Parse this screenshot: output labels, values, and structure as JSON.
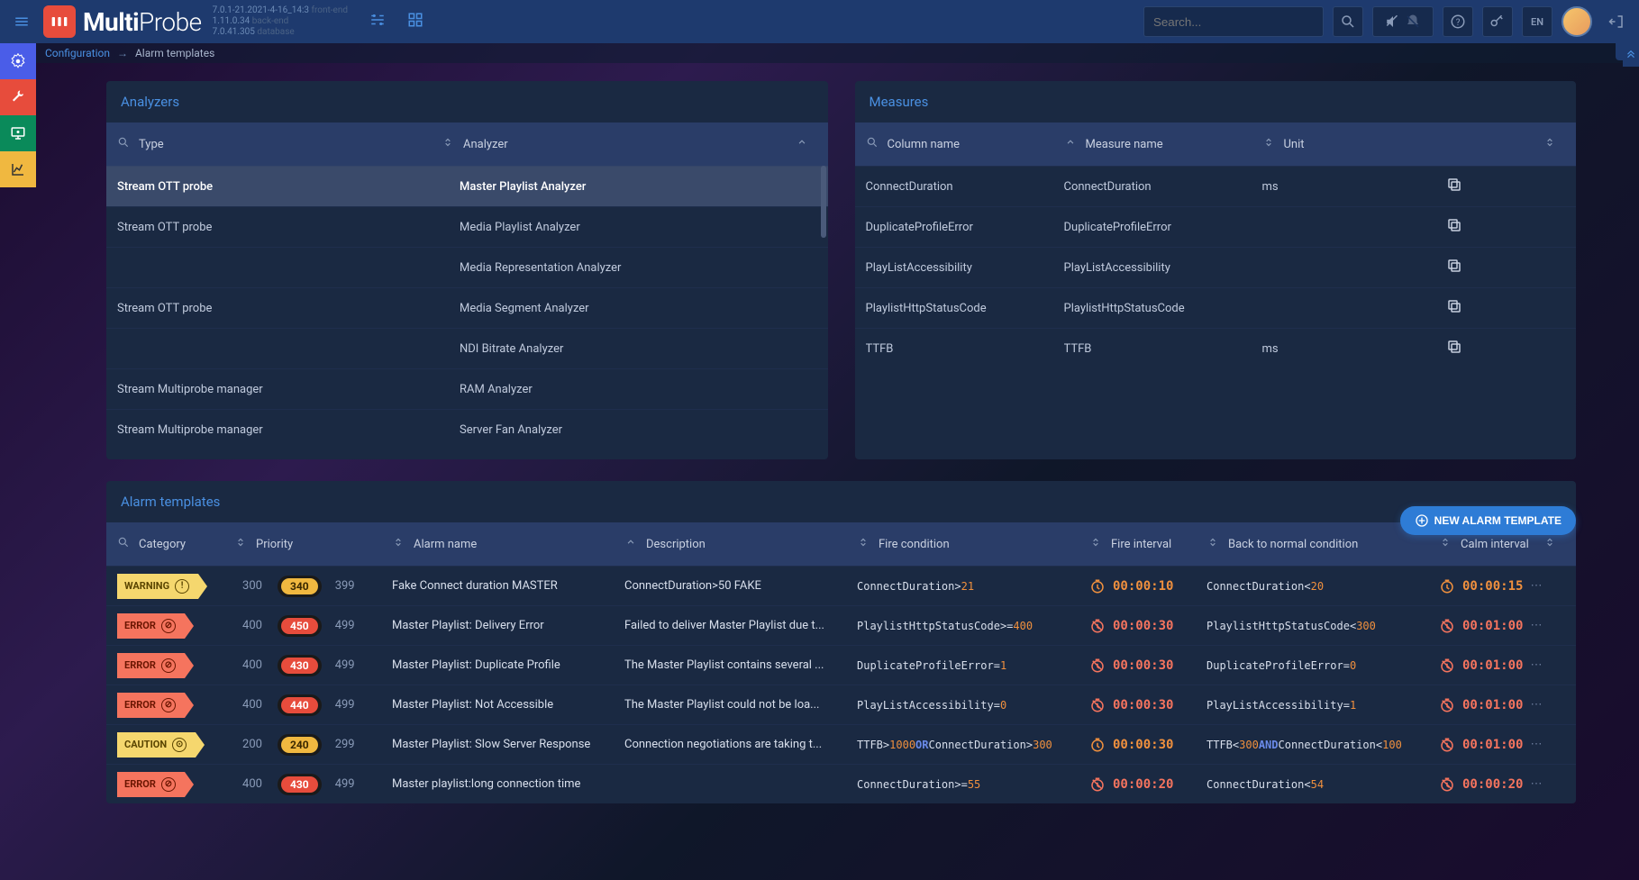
{
  "brand": {
    "name_bold": "Multi",
    "name_light": "Probe"
  },
  "versions": {
    "line1": "7.0.1-21.2021-4-16_14:3",
    "label1": "front-end",
    "line2": "1.11.0.34",
    "label2": "back-end",
    "line3": "7.0.41.305",
    "label3": "database"
  },
  "search": {
    "placeholder": "Search..."
  },
  "lang": "EN",
  "breadcrumb": {
    "root": "Configuration",
    "current": "Alarm templates",
    "sep": "→"
  },
  "analyzers": {
    "title": "Analyzers",
    "cols": {
      "type": "Type",
      "analyzer": "Analyzer"
    },
    "rows": [
      {
        "type": "Stream OTT probe",
        "analyzer": "Master Playlist Analyzer",
        "selected": true
      },
      {
        "type": "Stream OTT probe",
        "analyzer": "Media Playlist Analyzer"
      },
      {
        "type": "",
        "analyzer": "Media Representation Analyzer"
      },
      {
        "type": "Stream OTT probe",
        "analyzer": "Media Segment Analyzer"
      },
      {
        "type": "",
        "analyzer": "NDI Bitrate Analyzer"
      },
      {
        "type": "Stream Multiprobe manager",
        "analyzer": "RAM Analyzer"
      },
      {
        "type": "Stream Multiprobe manager",
        "analyzer": "Server Fan Analyzer"
      }
    ]
  },
  "measures": {
    "title": "Measures",
    "cols": {
      "column": "Column name",
      "measure": "Measure name",
      "unit": "Unit"
    },
    "rows": [
      {
        "col": "ConnectDuration",
        "meas": "ConnectDuration",
        "unit": "ms"
      },
      {
        "col": "DuplicateProfileError",
        "meas": "DuplicateProfileError",
        "unit": ""
      },
      {
        "col": "PlayListAccessibility",
        "meas": "PlayListAccessibility",
        "unit": ""
      },
      {
        "col": "PlaylistHttpStatusCode",
        "meas": "PlaylistHttpStatusCode",
        "unit": ""
      },
      {
        "col": "TTFB",
        "meas": "TTFB",
        "unit": "ms"
      }
    ]
  },
  "templates": {
    "title": "Alarm templates",
    "new_btn": "NEW ALARM TEMPLATE",
    "cols": {
      "category": "Category",
      "priority": "Priority",
      "name": "Alarm name",
      "desc": "Description",
      "firecond": "Fire condition",
      "fireint": "Fire interval",
      "back": "Back to normal condition",
      "calm": "Calm interval"
    },
    "rows": [
      {
        "cat": "WARNING",
        "cat_class": "warning",
        "cat_icon": "!",
        "pri1": "300",
        "pill": "340",
        "pill_class": "yellow",
        "pri2": "399",
        "name": "Fake Connect duration MASTER",
        "desc": "ConnectDuration>50 FAKE",
        "fire": [
          {
            "t": "key",
            "v": "ConnectDuration"
          },
          {
            "t": "op",
            "v": ">"
          },
          {
            "t": "val",
            "v": "21"
          }
        ],
        "fireint": "00:00:10",
        "fireint_class": "amber",
        "back": [
          {
            "t": "key",
            "v": "ConnectDuration"
          },
          {
            "t": "op",
            "v": "<"
          },
          {
            "t": "val",
            "v": "20"
          }
        ],
        "calm": "00:00:15",
        "calm_class": "amber"
      },
      {
        "cat": "ERROR",
        "cat_class": "error",
        "cat_icon": "⊘",
        "pri1": "400",
        "pill": "450",
        "pill_class": "red",
        "pri2": "499",
        "name": "Master Playlist: Delivery Error",
        "desc": "Failed to deliver Master Playlist due t...",
        "fire": [
          {
            "t": "key",
            "v": "PlaylistHttpStatusCode"
          },
          {
            "t": "op",
            "v": ">="
          },
          {
            "t": "val",
            "v": "400"
          }
        ],
        "fireint": "00:00:30",
        "fireint_class": "red",
        "back": [
          {
            "t": "key",
            "v": "PlaylistHttpStatusCode"
          },
          {
            "t": "op",
            "v": "<"
          },
          {
            "t": "val",
            "v": "300"
          }
        ],
        "calm": "00:01:00",
        "calm_class": "red"
      },
      {
        "cat": "ERROR",
        "cat_class": "error",
        "cat_icon": "⊘",
        "pri1": "400",
        "pill": "430",
        "pill_class": "red",
        "pri2": "499",
        "name": "Master Playlist: Duplicate Profile",
        "desc": "The Master Playlist contains several ...",
        "fire": [
          {
            "t": "key",
            "v": "DuplicateProfileError"
          },
          {
            "t": "op",
            "v": "="
          },
          {
            "t": "val",
            "v": "1"
          }
        ],
        "fireint": "00:00:30",
        "fireint_class": "red",
        "back": [
          {
            "t": "key",
            "v": "DuplicateProfileError"
          },
          {
            "t": "op",
            "v": "="
          },
          {
            "t": "val",
            "v": "0"
          }
        ],
        "calm": "00:01:00",
        "calm_class": "red"
      },
      {
        "cat": "ERROR",
        "cat_class": "error",
        "cat_icon": "⊘",
        "pri1": "400",
        "pill": "440",
        "pill_class": "red",
        "pri2": "499",
        "name": "Master Playlist: Not Accessible",
        "desc": "The Master Playlist could not be loa...",
        "fire": [
          {
            "t": "key",
            "v": "PlayListAccessibility"
          },
          {
            "t": "op",
            "v": "="
          },
          {
            "t": "val",
            "v": "0"
          }
        ],
        "fireint": "00:00:30",
        "fireint_class": "red",
        "back": [
          {
            "t": "key",
            "v": "PlayListAccessibility"
          },
          {
            "t": "op",
            "v": "="
          },
          {
            "t": "val",
            "v": "1"
          }
        ],
        "calm": "00:01:00",
        "calm_class": "red"
      },
      {
        "cat": "CAUTION",
        "cat_class": "caution",
        "cat_icon": "⊙",
        "pri1": "200",
        "pill": "240",
        "pill_class": "yellow",
        "pri2": "299",
        "name": "Master Playlist: Slow Server Response",
        "desc": "Connection negotiations are taking t...",
        "fire": [
          {
            "t": "key",
            "v": "TTFB"
          },
          {
            "t": "op",
            "v": ">"
          },
          {
            "t": "val",
            "v": "1000"
          },
          {
            "t": "kw",
            "v": " OR "
          },
          {
            "t": "key",
            "v": "ConnectDuration"
          },
          {
            "t": "op",
            "v": ">"
          },
          {
            "t": "val",
            "v": "300"
          }
        ],
        "fireint": "00:00:30",
        "fireint_class": "amber",
        "back": [
          {
            "t": "key",
            "v": "TTFB"
          },
          {
            "t": "op",
            "v": "<"
          },
          {
            "t": "val",
            "v": "300"
          },
          {
            "t": "kw",
            "v": " AND "
          },
          {
            "t": "key",
            "v": "ConnectDuration"
          },
          {
            "t": "op",
            "v": "<"
          },
          {
            "t": "val",
            "v": "100"
          }
        ],
        "calm": "00:01:00",
        "calm_class": "red"
      },
      {
        "cat": "ERROR",
        "cat_class": "error",
        "cat_icon": "⊘",
        "pri1": "400",
        "pill": "430",
        "pill_class": "red",
        "pri2": "499",
        "name": "Master playlist:long connection time",
        "desc": "",
        "fire": [
          {
            "t": "key",
            "v": "ConnectDuration"
          },
          {
            "t": "op",
            "v": ">="
          },
          {
            "t": "val",
            "v": "55"
          }
        ],
        "fireint": "00:00:20",
        "fireint_class": "red",
        "back": [
          {
            "t": "key",
            "v": "ConnectDuration"
          },
          {
            "t": "op",
            "v": "<"
          },
          {
            "t": "val",
            "v": "54"
          }
        ],
        "calm": "00:00:20",
        "calm_class": "red"
      }
    ]
  }
}
